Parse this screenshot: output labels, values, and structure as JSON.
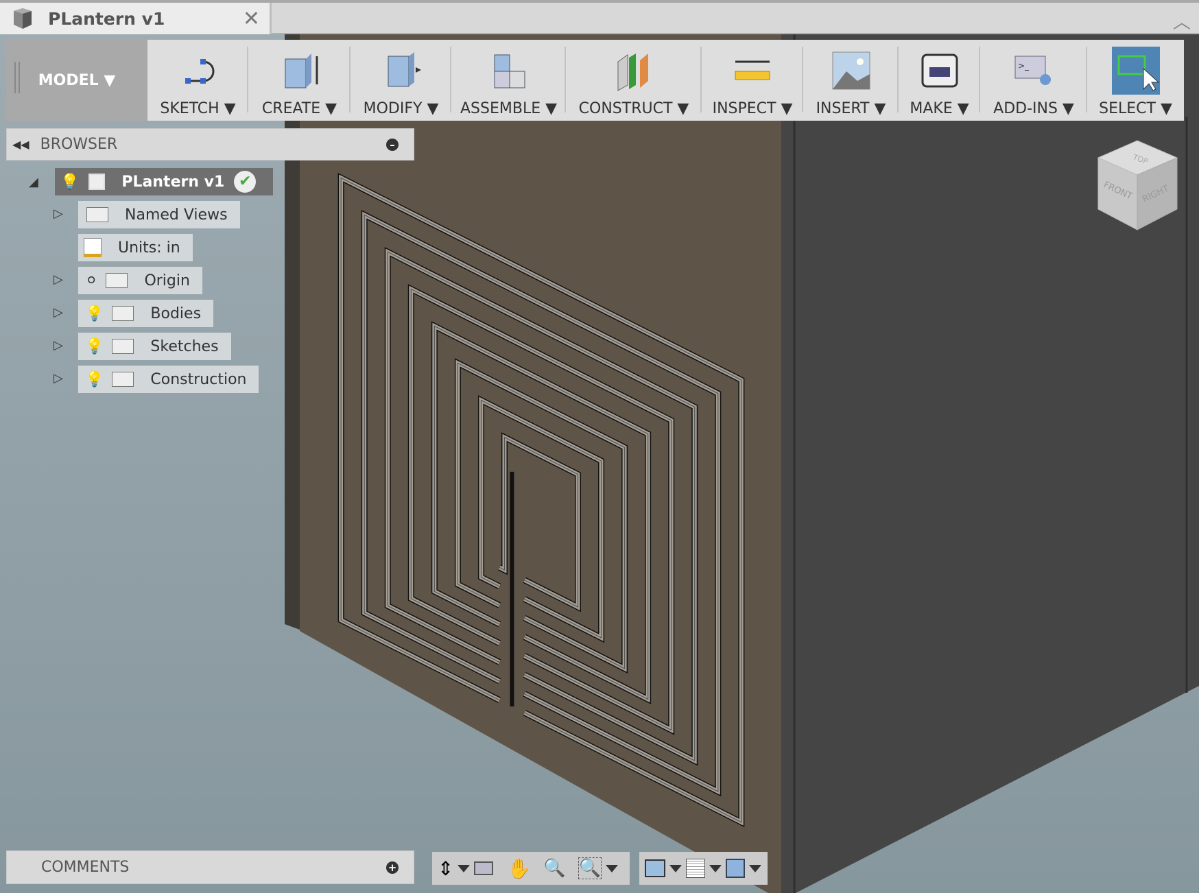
{
  "document": {
    "title": "PLantern v1",
    "close_icon": "close-icon",
    "collapse_icon": "chevron-up-icon"
  },
  "toolbar": {
    "workspace": "MODEL ▼",
    "items": [
      {
        "label": "SKETCH ▼",
        "icon": "sketch-icon"
      },
      {
        "label": "CREATE ▼",
        "icon": "create-box-icon"
      },
      {
        "label": "MODIFY ▼",
        "icon": "modify-icon"
      },
      {
        "label": "ASSEMBLE ▼",
        "icon": "assemble-icon"
      },
      {
        "label": "CONSTRUCT ▼",
        "icon": "construct-plane-icon"
      },
      {
        "label": "INSPECT ▼",
        "icon": "measure-ruler-icon"
      },
      {
        "label": "INSERT ▼",
        "icon": "insert-image-icon"
      },
      {
        "label": "MAKE ▼",
        "icon": "3d-print-icon"
      },
      {
        "label": "ADD-INS ▼",
        "icon": "script-gear-icon"
      },
      {
        "label": "SELECT ▼",
        "icon": "select-cursor-icon"
      }
    ]
  },
  "browser": {
    "title": "BROWSER",
    "root": "PLantern v1",
    "items": [
      {
        "label": "Named Views",
        "visible_icon": false
      },
      {
        "label": "Units: in",
        "visible_icon": false
      },
      {
        "label": "Origin",
        "visible_icon": true
      },
      {
        "label": "Bodies",
        "visible_icon": true
      },
      {
        "label": "Sketches",
        "visible_icon": true
      },
      {
        "label": "Construction",
        "visible_icon": true
      }
    ]
  },
  "comments": {
    "title": "COMMENTS"
  },
  "viewcube": {
    "top": "TOP",
    "front": "FRONT",
    "right": "RIGHT"
  },
  "colors": {
    "accent": "#4f85b5",
    "wall_face": "#5f5448",
    "side_face": "#454545",
    "maze": "#a59e94"
  }
}
